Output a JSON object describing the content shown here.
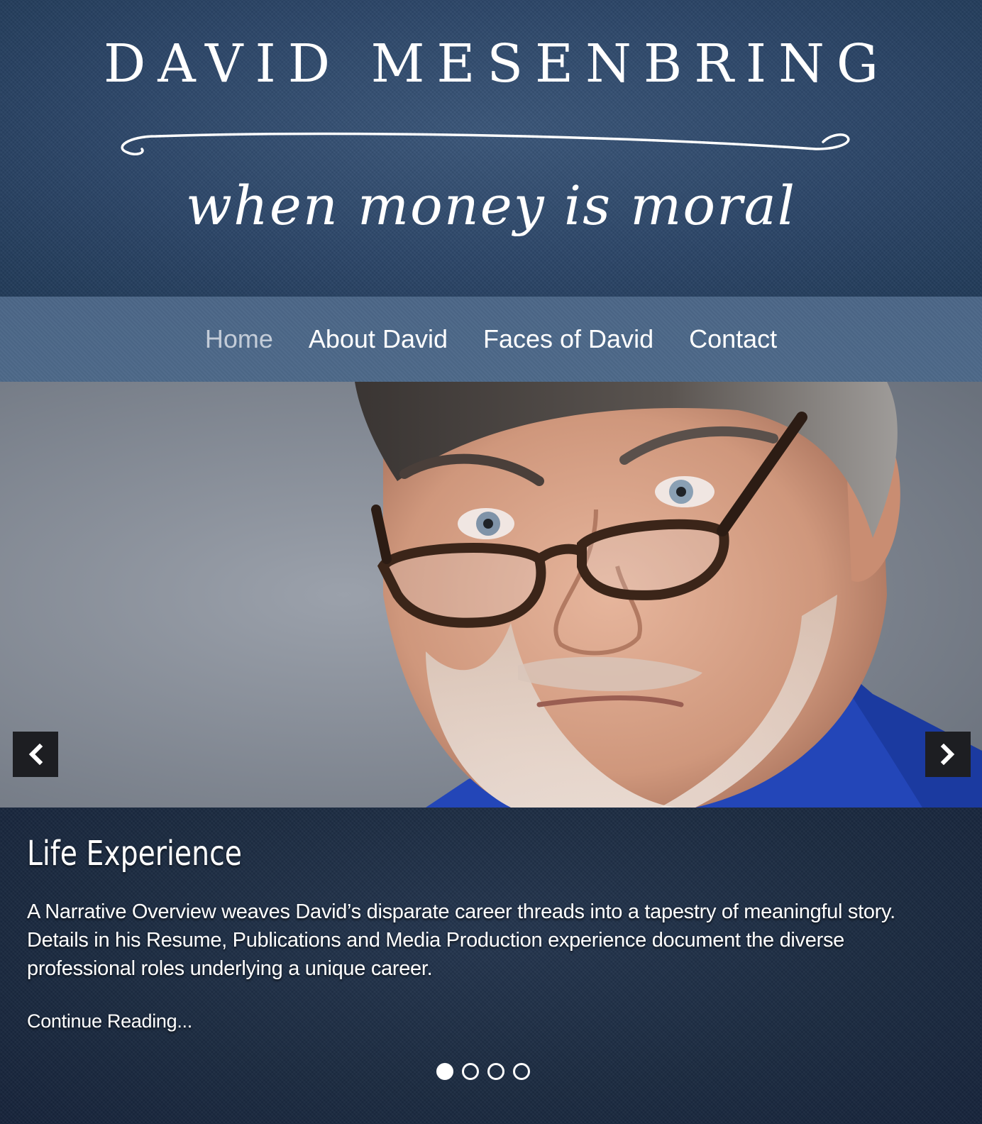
{
  "header": {
    "title": "DAVID MESENBRING",
    "tagline": "when money is moral"
  },
  "nav": {
    "items": [
      {
        "label": "Home",
        "active": true
      },
      {
        "label": "About David",
        "active": false
      },
      {
        "label": "Faces of David",
        "active": false
      },
      {
        "label": "Contact",
        "active": false
      }
    ]
  },
  "slider": {
    "prev_icon": "chevron-left-icon",
    "next_icon": "chevron-right-icon",
    "slide_title": "Life Experience",
    "slide_text": "A Narrative Overview weaves David’s disparate career threads into a tapestry of meaningful story. Details in his Resume, Publications and Media Production experience document the diverse professional roles underlying a unique career.",
    "continue_label": "Continue Reading...",
    "dot_count": 4,
    "active_dot": 1
  },
  "colors": {
    "header_bg": "#2c4668",
    "nav_bg": "#4b6687",
    "caption_bg": "#1b2a40",
    "arrow_bg": "#1d1e22"
  }
}
